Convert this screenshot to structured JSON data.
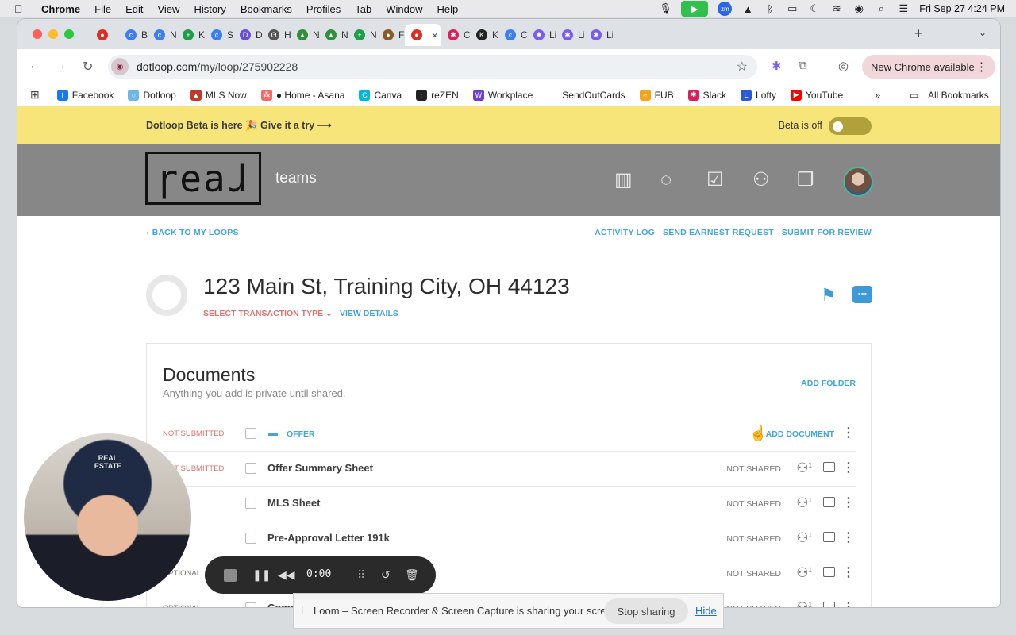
{
  "menubar": {
    "apple": "",
    "app_name": "Chrome",
    "items": [
      "File",
      "Edit",
      "View",
      "History",
      "Bookmarks",
      "Profiles",
      "Tab",
      "Window",
      "Help"
    ],
    "clock": "Fri Sep 27  4:24 PM"
  },
  "tabs": [
    {
      "label": "",
      "color": "#d93025",
      "glyph": "●"
    },
    {
      "label": "Bu",
      "color": "#3d7df2",
      "glyph": "c"
    },
    {
      "label": "Ne",
      "color": "#3d7df2",
      "glyph": "c"
    },
    {
      "label": "Ke",
      "color": "#1e9e4a",
      "glyph": "+"
    },
    {
      "label": "Se",
      "color": "#3d7df2",
      "glyph": "c"
    },
    {
      "label": "De",
      "color": "#6b4fd6",
      "glyph": "D"
    },
    {
      "label": "Ho",
      "color": "#555555",
      "glyph": "ʘ"
    },
    {
      "label": "NC",
      "color": "#2f8f3b",
      "glyph": "▲"
    },
    {
      "label": "NC",
      "color": "#2f8f3b",
      "glyph": "▲"
    },
    {
      "label": "NC",
      "color": "#1e9e4a",
      "glyph": "+"
    },
    {
      "label": "Fa",
      "color": "#8a5a2b",
      "glyph": "●"
    },
    {
      "label": "",
      "color": "#d93025",
      "glyph": "●",
      "active": true
    },
    {
      "label": "Ca",
      "color": "#e01e5a",
      "glyph": "✱"
    },
    {
      "label": "KG",
      "color": "#222222",
      "glyph": "K"
    },
    {
      "label": "Co",
      "color": "#3d7df2",
      "glyph": "c"
    },
    {
      "label": "Lil",
      "color": "#7b5cf0",
      "glyph": "✱"
    },
    {
      "label": "Lil",
      "color": "#7b5cf0",
      "glyph": "✱"
    },
    {
      "label": "Lil",
      "color": "#7b5cf0",
      "glyph": "✱"
    }
  ],
  "toolbar": {
    "url_domain": "dotloop.com",
    "url_path": "/my/loop/275902228",
    "update_label": "New Chrome available"
  },
  "bookmarks": [
    {
      "label": "Facebook",
      "color": "#1877f2",
      "glyph": "f"
    },
    {
      "label": "Dotloop",
      "color": "#6fb6e8",
      "glyph": "○"
    },
    {
      "label": "MLS Now",
      "color": "#c0392b",
      "glyph": "▲"
    },
    {
      "label": "● Home - Asana",
      "color": "#f06a6a",
      "glyph": "⁂"
    },
    {
      "label": "Canva",
      "color": "#00b8d9",
      "glyph": "C"
    },
    {
      "label": "reZEN",
      "color": "#222222",
      "glyph": "r"
    },
    {
      "label": "Workplace",
      "color": "#6b3fd6",
      "glyph": "W"
    },
    {
      "label": "SendOutCards",
      "color": "#ffffff",
      "glyph": ""
    },
    {
      "label": "FUB",
      "color": "#f7a21b",
      "glyph": "≈"
    },
    {
      "label": "Slack",
      "color": "#e01e5a",
      "glyph": "✱"
    },
    {
      "label": "Lofty",
      "color": "#2a5bd7",
      "glyph": "L"
    },
    {
      "label": "YouTube",
      "color": "#ff0000",
      "glyph": "▶"
    }
  ],
  "bookmarks_more": "»",
  "bookmarks_all": "All Bookmarks",
  "beta": {
    "banner_text": "Dotloop Beta is here 🎉 Give it a try ⟶",
    "status_text": "Beta is off"
  },
  "header": {
    "logo_text": "ɼeaɺ",
    "subtitle": "teams"
  },
  "topnav": {
    "back": "BACK TO MY LOOPS",
    "links": [
      "ACTIVITY LOG",
      "SEND EARNEST REQUEST",
      "SUBMIT FOR REVIEW"
    ]
  },
  "loop": {
    "address": "123 Main St, Training City, OH 44123",
    "transaction_type": "SELECT TRANSACTION TYPE ⌄",
    "view_details": "VIEW DETAILS"
  },
  "documents": {
    "title": "Documents",
    "subtitle": "Anything you add is private until shared.",
    "add_folder": "ADD FOLDER",
    "folder": {
      "status": "NOT SUBMITTED",
      "name": "OFFER",
      "add_document": "ADD DOCUMENT"
    },
    "rows": [
      {
        "status": "NOT SUBMITTED",
        "name": "Offer Summary Sheet",
        "shared": "NOT SHARED",
        "people": "1"
      },
      {
        "status": "",
        "name": "MLS Sheet",
        "shared": "NOT SHARED",
        "people": "1"
      },
      {
        "status": "",
        "name": "Pre-Approval Letter 191k",
        "shared": "NOT SHARED",
        "people": "1"
      },
      {
        "status": "OPTIONAL",
        "name": "",
        "shared": "NOT SHARED",
        "people": "1"
      },
      {
        "status": "OPTIONAL",
        "name": "Comp",
        "shared": "NOT SHARED",
        "people": "1"
      }
    ]
  },
  "webcam": {
    "hat_text": "REAL ESTATE"
  },
  "loom": {
    "time": "0:00",
    "share_text": "Loom – Screen Recorder & Screen Capture is sharing your screen.",
    "stop_label": "Stop sharing",
    "hide_label": "Hide"
  }
}
